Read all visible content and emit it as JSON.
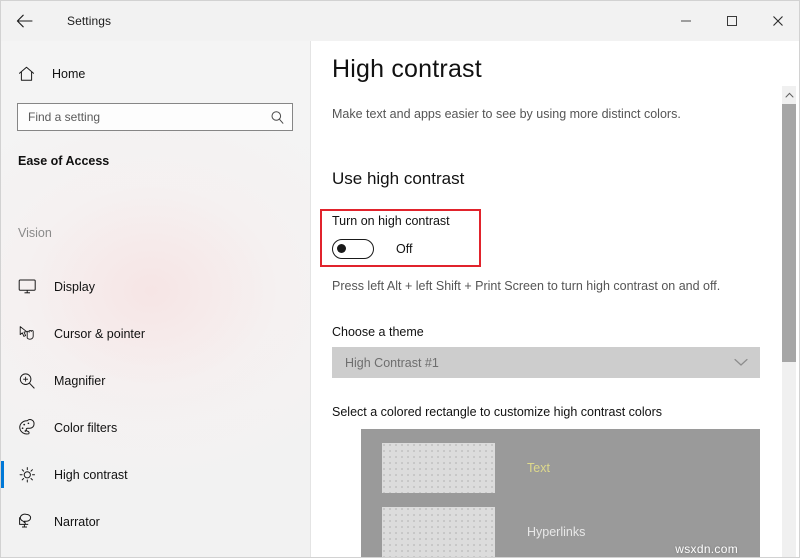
{
  "titlebar": {
    "back_icon": "back-arrow-icon",
    "title": "Settings",
    "minimize_icon": "minimize-icon",
    "maximize_icon": "maximize-icon",
    "close_icon": "close-icon"
  },
  "sidebar": {
    "home": {
      "icon": "home-icon",
      "label": "Home"
    },
    "search": {
      "placeholder": "Find a setting",
      "value": "",
      "icon": "search-icon"
    },
    "section_title": "Ease of Access",
    "group_label": "Vision",
    "items": [
      {
        "label": "Display",
        "icon": "monitor-icon",
        "selected": false
      },
      {
        "label": "Cursor & pointer",
        "icon": "cursor-icon",
        "selected": false
      },
      {
        "label": "Magnifier",
        "icon": "magnifier-icon",
        "selected": false
      },
      {
        "label": "Color filters",
        "icon": "palette-icon",
        "selected": false
      },
      {
        "label": "High contrast",
        "icon": "brightness-icon",
        "selected": true
      },
      {
        "label": "Narrator",
        "icon": "narrator-icon",
        "selected": false
      }
    ],
    "accent_color": "#0078d7"
  },
  "content": {
    "page_title": "High contrast",
    "description": "Make text and apps easier to see by using more distinct colors.",
    "section_heading": "Use high contrast",
    "toggle": {
      "label": "Turn on high contrast",
      "state": "Off",
      "checked": false
    },
    "highlight_box_color": "#e1232c",
    "hint": "Press left Alt + left Shift + Print Screen to turn high contrast on and off.",
    "theme": {
      "label": "Choose a theme",
      "selected": "High Contrast #1",
      "chevron_icon": "chevron-down-icon",
      "disabled": true
    },
    "rectangles": {
      "label": "Select a colored rectangle to customize high contrast colors",
      "panel_background": "#9a9a9a",
      "swatch_color": "#dcdcdc",
      "rows": [
        {
          "sample_label": "Text",
          "sample_color": "#ded98b"
        },
        {
          "sample_label": "Hyperlinks",
          "sample_color": "#e8e8e8"
        }
      ]
    },
    "watermark": "wsxdn.com"
  },
  "scrollbar": {
    "up_icon": "chevron-up-icon"
  }
}
